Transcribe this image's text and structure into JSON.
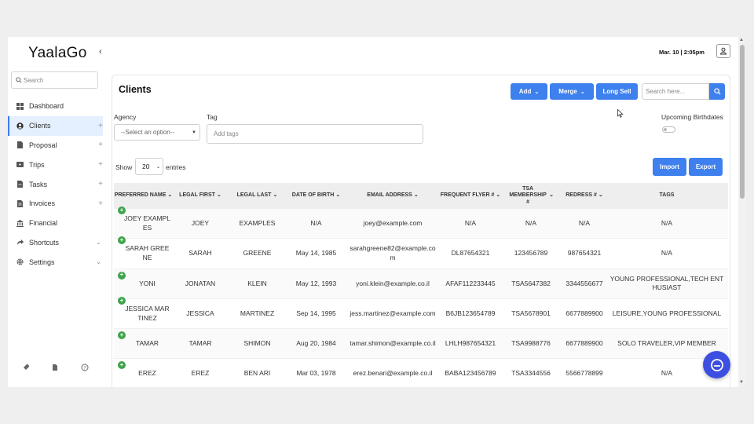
{
  "app": {
    "logo": "YaalaGo",
    "datetime": "Mar. 10 | 2:05pm"
  },
  "sidebar": {
    "search_placeholder": "Search",
    "items": [
      {
        "label": "Dashboard",
        "icon": "dashboard-icon",
        "suffix": ""
      },
      {
        "label": "Clients",
        "icon": "clients-icon",
        "suffix": "+"
      },
      {
        "label": "Proposal",
        "icon": "document-icon",
        "suffix": "+"
      },
      {
        "label": "Trips",
        "icon": "trips-icon",
        "suffix": "+"
      },
      {
        "label": "Tasks",
        "icon": "tasks-icon",
        "suffix": "+"
      },
      {
        "label": "Invoices",
        "icon": "invoice-icon",
        "suffix": "+"
      },
      {
        "label": "Financial",
        "icon": "financial-icon",
        "suffix": ""
      },
      {
        "label": "Shortcuts",
        "icon": "share-icon",
        "suffix": "⌄"
      },
      {
        "label": "Settings",
        "icon": "gear-icon",
        "suffix": "⌄"
      }
    ]
  },
  "page": {
    "title": "Clients",
    "add_label": "Add",
    "merge_label": "Merge",
    "long_sell_label": "Long Sell",
    "search_placeholder": "Search here...",
    "agency_label": "Agency",
    "agency_placeholder": "--Select an option--",
    "tag_label": "Tag",
    "tag_placeholder": "Add tags",
    "birthdates_label": "Upcoming Birthdates",
    "show_label": "Show",
    "entries_value": "20",
    "entries_label": "entries",
    "import_label": "Import",
    "export_label": "Export"
  },
  "table": {
    "headers": [
      "PREFERRED NAME",
      "LEGAL FIRST",
      "LEGAL LAST",
      "DATE OF BIRTH",
      "EMAIL ADDRESS",
      "FREQUENT FLYER #",
      "TSA MEMBERSHIP #",
      "REDRESS #",
      "TAGS"
    ],
    "rows": [
      [
        "JOEY EXAMPLES",
        "JOEY",
        "EXAMPLES",
        "N/A",
        "joey@example.com",
        "N/A",
        "N/A",
        "N/A",
        "N/A"
      ],
      [
        "SARAH GREENE",
        "SARAH",
        "GREENE",
        "May 14, 1985",
        "sarahgreene82@example.com",
        "DL87654321",
        "123456789",
        "987654321",
        "N/A"
      ],
      [
        "YONI",
        "JONATAN",
        "KLEIN",
        "May 12, 1993",
        "yoni.klein@example.co.il",
        "AFAF112233445",
        "TSA5647382",
        "3344556677",
        "YOUNG PROFESSIONAL,TECH ENTHUSIAST"
      ],
      [
        "JESSICA MARTINEZ",
        "JESSICA",
        "MARTINEZ",
        "Sep 14, 1995",
        "jess.martinez@example.com",
        "B6JB123654789",
        "TSA5678901",
        "6677889900",
        "LEISURE,YOUNG PROFESSIONAL"
      ],
      [
        "TAMAR",
        "TAMAR",
        "SHIMON",
        "Aug 20, 1984",
        "tamar.shimon@example.co.il",
        "LHLH987654321",
        "TSA9988776",
        "6677889900",
        "SOLO TRAVELER,VIP MEMBER"
      ],
      [
        "EREZ",
        "EREZ",
        "BEN ARI",
        "Mar 03, 1978",
        "erez.benari@example.co.il",
        "BABA123456789",
        "TSA3344556",
        "5566778899",
        "N/A"
      ]
    ]
  },
  "colors": {
    "accent": "#3d80ee",
    "chat": "#3d4fe0",
    "expand": "#3fa34d"
  }
}
